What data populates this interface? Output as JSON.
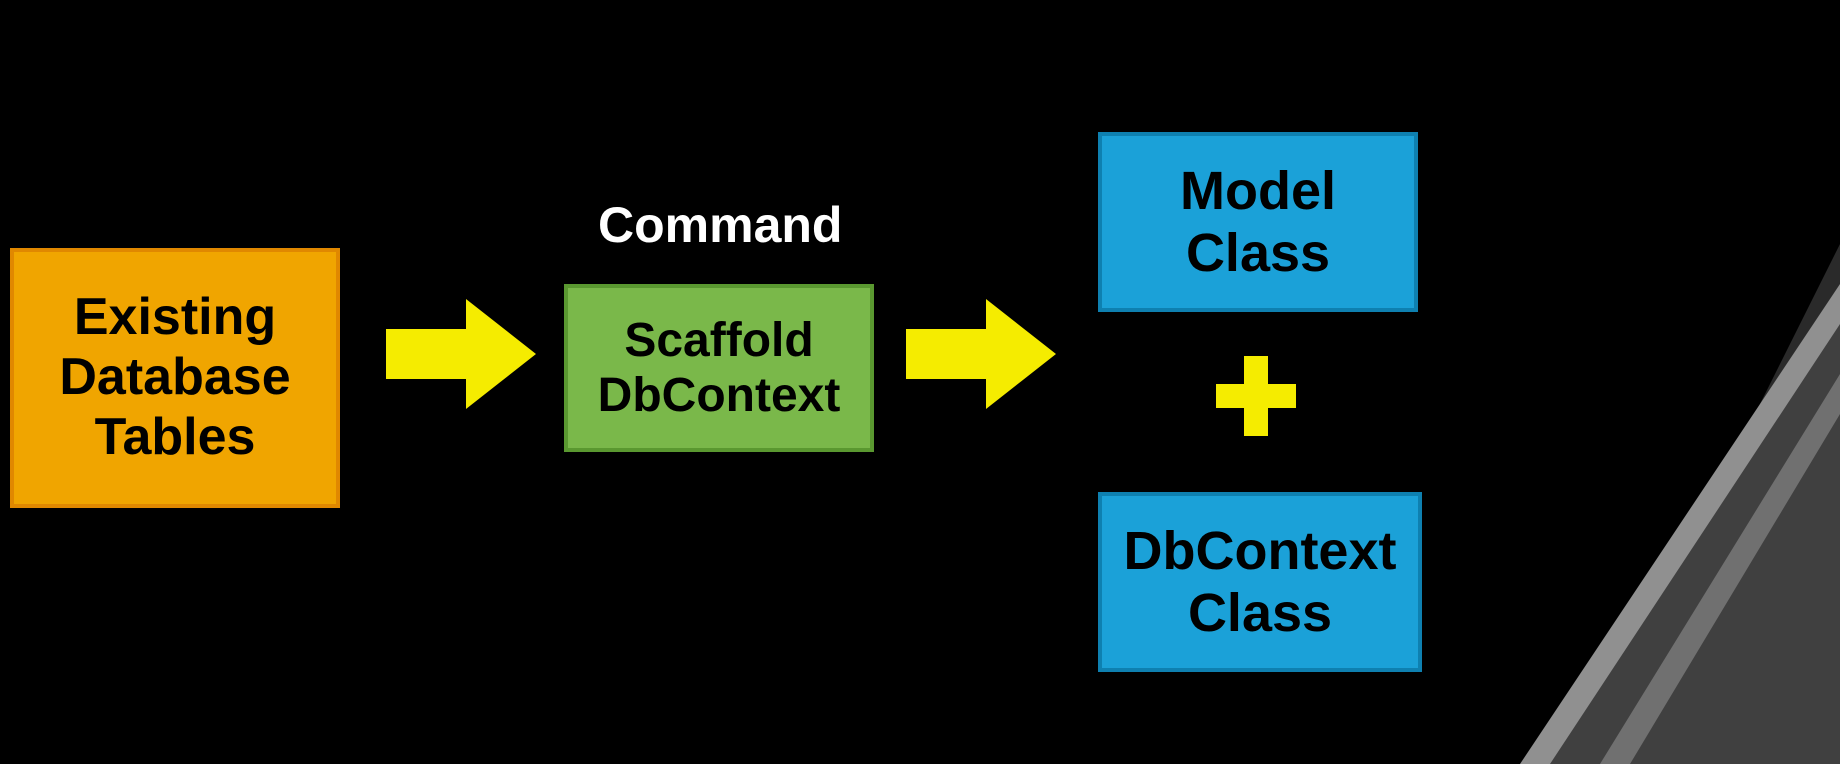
{
  "boxes": {
    "existing": {
      "line1": "Existing",
      "line2": "Database",
      "line3": "Tables"
    },
    "scaffold": {
      "line1": "Scaffold",
      "line2": "DbContext"
    },
    "model": {
      "line1": "Model",
      "line2": "Class"
    },
    "dbcontext": {
      "line1": "DbContext",
      "line2": "Class"
    }
  },
  "labels": {
    "command": "Command"
  },
  "colors": {
    "orange": "#f0a500",
    "green": "#7ab84a",
    "blue": "#1ba1d8",
    "yellow": "#f5ec00"
  }
}
